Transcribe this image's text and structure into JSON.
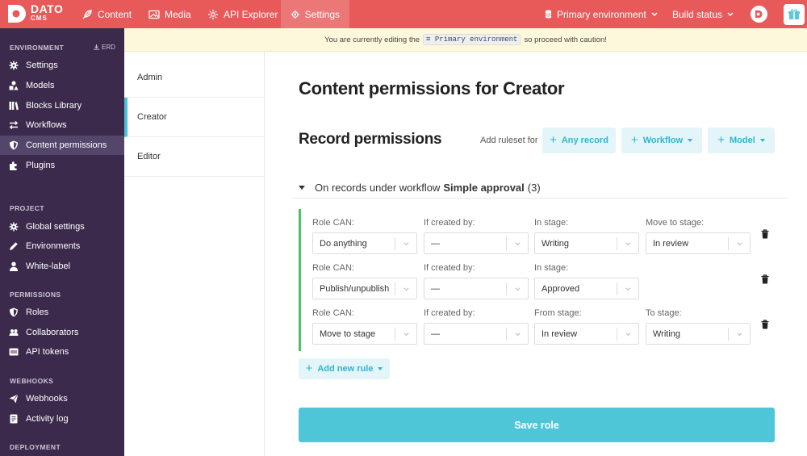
{
  "brand": {
    "line1": "DATO",
    "line2": "CMS",
    "color": "#e85a5a"
  },
  "nav": {
    "tabs": [
      {
        "label": "Content",
        "icon": "feather-icon"
      },
      {
        "label": "Media",
        "icon": "image-icon"
      },
      {
        "label": "API Explorer",
        "icon": "gear-outline-icon"
      },
      {
        "label": "Settings",
        "icon": "gear-icon",
        "active": true
      }
    ],
    "environment": "Primary environment",
    "build_status": "Build status"
  },
  "sidebar": {
    "sections": {
      "environment": "ENVIRONMENT",
      "erd": "ERD",
      "project": "PROJECT",
      "permissions": "PERMISSIONS",
      "webhooks": "WEBHOOKS",
      "deployment": "DEPLOYMENT"
    },
    "items": [
      {
        "label": "Settings",
        "icon": "gear-icon"
      },
      {
        "label": "Models",
        "icon": "shapes-icon"
      },
      {
        "label": "Blocks Library",
        "icon": "books-icon"
      },
      {
        "label": "Workflows",
        "icon": "arrows-icon"
      },
      {
        "label": "Content permissions",
        "icon": "shield-icon",
        "active": true
      },
      {
        "label": "Plugins",
        "icon": "puzzle-icon"
      },
      {
        "label": "Global settings",
        "icon": "gear-icon"
      },
      {
        "label": "Environments",
        "icon": "pencil-icon"
      },
      {
        "label": "White-label",
        "icon": "user-icon"
      },
      {
        "label": "Roles",
        "icon": "shield-icon"
      },
      {
        "label": "Collaborators",
        "icon": "users-icon"
      },
      {
        "label": "API tokens",
        "icon": "token-icon"
      },
      {
        "label": "Webhooks",
        "icon": "send-icon"
      },
      {
        "label": "Activity log",
        "icon": "log-icon"
      }
    ],
    "accent": "#3b2a4c"
  },
  "banner": {
    "before": "You are currently editing the",
    "env": "Primary environment",
    "after": "so proceed with caution!"
  },
  "roles": [
    "Admin",
    "Creator",
    "Editor"
  ],
  "main": {
    "title": "Content permissions for Creator",
    "record_permissions": "Record permissions",
    "add_ruleset_label": "Add ruleset for",
    "ruleset_buttons": [
      "Any record",
      "Workflow",
      "Model"
    ],
    "workflow_group": {
      "prefix": "On records under workflow",
      "name": "Simple approval",
      "count": "(3)"
    },
    "rules": [
      {
        "labels": [
          "Role CAN:",
          "If created by:",
          "In stage:",
          "Move to stage:"
        ],
        "values": [
          "Do anything",
          "—",
          "Writing",
          "In review"
        ]
      },
      {
        "labels": [
          "Role CAN:",
          "If created by:",
          "In stage:"
        ],
        "values": [
          "Publish/unpublish",
          "—",
          "Approved"
        ]
      },
      {
        "labels": [
          "Role CAN:",
          "If created by:",
          "From stage:",
          "To stage:"
        ],
        "values": [
          "Move to stage",
          "—",
          "In review",
          "Writing"
        ]
      }
    ],
    "add_rule": "Add new rule",
    "save": "Save role",
    "accent": "#4ec6d8"
  }
}
